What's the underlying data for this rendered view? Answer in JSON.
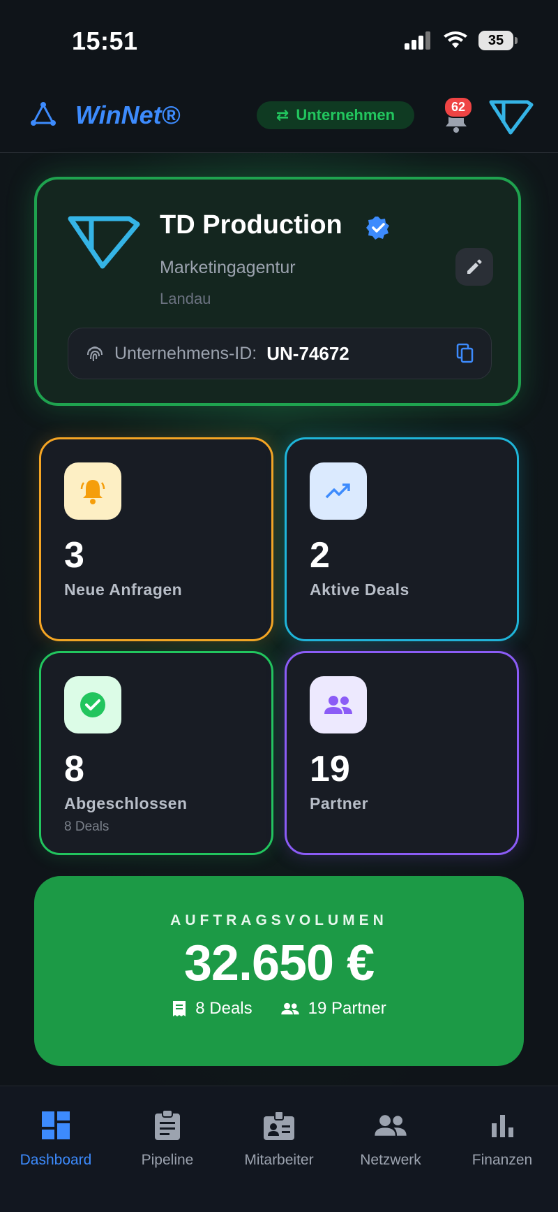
{
  "status_bar": {
    "time": "15:51",
    "battery": "35"
  },
  "header": {
    "brand": "WinNet®",
    "switch_label": "Unternehmen",
    "notification_count": "62"
  },
  "company": {
    "name": "TD Production",
    "type": "Marketingagentur",
    "city": "Landau",
    "id_label": "Unternehmens-ID:",
    "id_value": "UN-74672"
  },
  "stats": [
    {
      "value": "3",
      "label": "Neue Anfragen",
      "sub": "",
      "color": "#f5a524",
      "icon": "bell-icon"
    },
    {
      "value": "2",
      "label": "Aktive Deals",
      "sub": "",
      "color": "#1fb5d9",
      "icon": "trending-up-icon"
    },
    {
      "value": "8",
      "label": "Abgeschlossen",
      "sub": "8 Deals",
      "color": "#22c55e",
      "icon": "check-circle-icon"
    },
    {
      "value": "19",
      "label": "Partner",
      "sub": "",
      "color": "#8b5cf6",
      "icon": "people-icon"
    }
  ],
  "volume": {
    "label": "AUFTRAGSVOLUMEN",
    "amount": "32.650 €",
    "deals": "8 Deals",
    "partners": "19 Partner"
  },
  "nav": {
    "items": [
      {
        "label": "Dashboard",
        "active": true
      },
      {
        "label": "Pipeline"
      },
      {
        "label": "Mitarbeiter"
      },
      {
        "label": "Netzwerk"
      },
      {
        "label": "Finanzen"
      }
    ]
  },
  "colors": {
    "accent": "#3d8bfd",
    "success": "#22c55e",
    "volume_bg": "#1c9a46"
  }
}
